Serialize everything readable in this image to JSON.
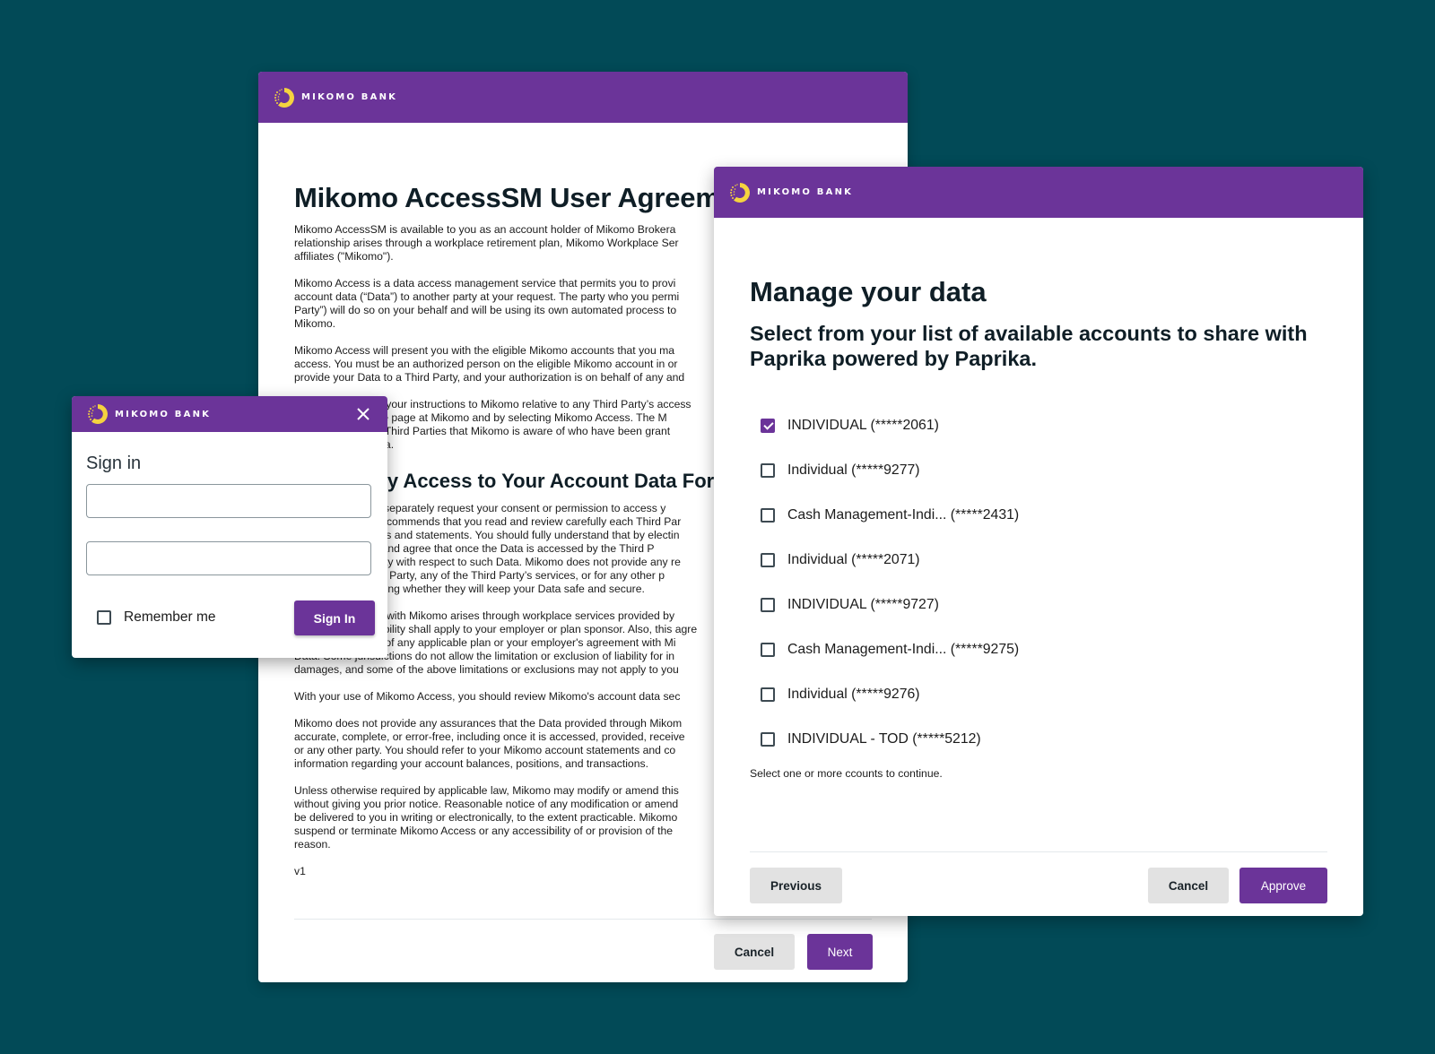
{
  "brand": {
    "name": "MIKOMO BANK",
    "logo_icon": "mikomo-ring-logo-icon",
    "colors": {
      "background": "#024a57",
      "brand_purple": "#6b3499",
      "logo_yellow": "#f5d33f",
      "button_gray": "#e2e2e2"
    }
  },
  "agreement": {
    "title": "Mikomo AccessSM User Agreem",
    "paragraphs": [
      [
        "Mikomo AccessSM is available to you as an account holder of Mikomo Brokera",
        "relationship arises through a workplace retirement plan, Mikomo Workplace Ser",
        "affiliates (\"Mikomo\")."
      ],
      [
        "Mikomo Access is a data access management service that permits you to provi",
        "account data (“Data”) to another party at your request. The party who you permi",
        "Party”) will do so on your behalf and will be using its own automated process to",
        "Mikomo."
      ],
      [
        "Mikomo Access will present you with the eligible Mikomo accounts that you ma",
        "access. You must be an authorized person on the eligible Mikomo account in or",
        "provide your Data to a Third Party, and your authorization is on behalf of any and"
      ],
      [
        "Mikomo relative to your instructions to Mikomo relative to any Third Party’s access",
        "through your profile page at Mikomo and by selecting Mikomo Access. The M",
        "information on the Third Parties that Mikomo is aware of who have been grant",
        "access to your Data."
      ]
    ],
    "section_heading": "Third Party Access to Your Account Data For",
    "section_paragraphs": [
      [
        "A Third Party may separately request your consent or permission to access y",
        "Mikomo strongly recommends that you read and review carefully each Third Par",
        "policies, disclosures and statements. You should fully understand that by electin",
        "you acknowledge and agree that once the Data is accessed by the Third P",
        "has no responsibility with respect to such Data. Mikomo does not provide any re",
        "regarding the Third Party, any of the Third Party’s services, or for any other p",
        "or practices, including whether they will keep your Data safe and secure."
      ],
      [
        "If your relationship with Mikomo arises through workplace services provided by",
        "this limitation of liability shall apply to your employer or plan sponsor. Also, this agre",
        "or affect the terms of any applicable plan or your employer's agreement with Mi",
        "Data. Some jurisdictions do not allow the limitation or exclusion of liability for in",
        "damages, and some of the above limitations or exclusions may not apply to you"
      ],
      [
        "With your use of Mikomo Access, you should review Mikomo's account data sec"
      ],
      [
        "Mikomo does not provide any assurances that the Data provided through Mikom",
        "accurate, complete, or error-free, including once it is accessed, provided, receive",
        "or any other party. You should refer to your Mikomo account statements and co",
        "information regarding your account balances, positions, and transactions."
      ],
      [
        "Unless otherwise required by applicable law, Mikomo may modify or amend this",
        "without giving you prior notice. Reasonable notice of any modification or amend",
        "be delivered to you in writing or electronically, to the extent practicable. Mikomo",
        "suspend or terminate Mikomo Access or any accessibility of or provision of the",
        "reason."
      ],
      [
        "v1"
      ]
    ],
    "cancel_label": "Cancel",
    "next_label": "Next"
  },
  "signin": {
    "title": "Sign in",
    "close_icon": "close-icon",
    "username_value": "",
    "password_value": "",
    "remember_label": "Remember me",
    "remember_checked": false,
    "submit_label": "Sign In"
  },
  "manage": {
    "title": "Manage your data",
    "subtitle": "Select from your list of available accounts to share with Paprika powered by Paprika.",
    "accounts": [
      {
        "label": "INDIVIDUAL (*****2061)",
        "checked": true
      },
      {
        "label": "Individual (*****9277)",
        "checked": false
      },
      {
        "label": "Cash Management-Indi... (*****2431)",
        "checked": false
      },
      {
        "label": "Individual (*****2071)",
        "checked": false
      },
      {
        "label": "INDIVIDUAL (*****9727)",
        "checked": false
      },
      {
        "label": "Cash Management-Indi... (*****9275)",
        "checked": false
      },
      {
        "label": "Individual (*****9276)",
        "checked": false
      },
      {
        "label": "INDIVIDUAL - TOD (*****5212)",
        "checked": false
      }
    ],
    "hint": "Select one or more ccounts to continue.",
    "previous_label": "Previous",
    "cancel_label": "Cancel",
    "approve_label": "Approve"
  }
}
